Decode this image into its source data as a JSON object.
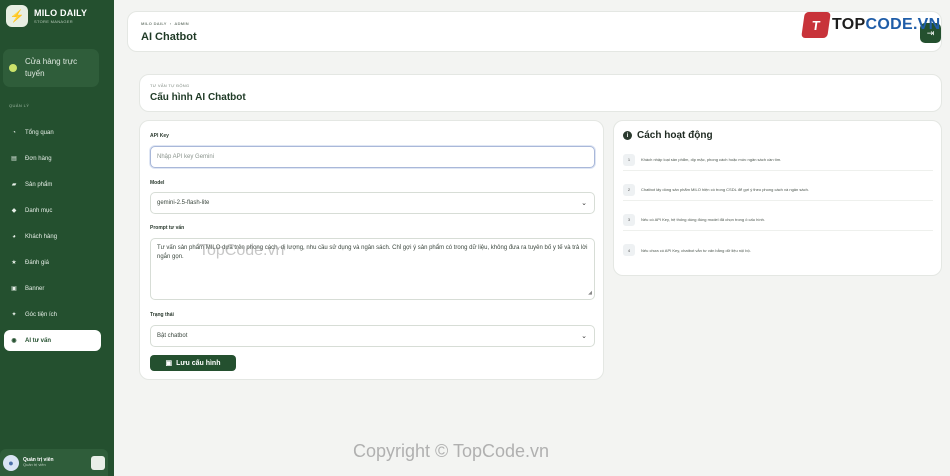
{
  "brand": {
    "name": "MILO DAILY",
    "subtitle": "STORE MANAGER",
    "logo_icon": "bolt-icon"
  },
  "store": {
    "label": "Cửa hàng trực tuyến",
    "status_color": "#cbe36a"
  },
  "sidebar": {
    "section_label": "QUẢN LÝ",
    "items": [
      {
        "label": "Tổng quan",
        "icon": "dashboard-icon",
        "glyph": "◔",
        "active": false
      },
      {
        "label": "Đơn hàng",
        "icon": "receipt-icon",
        "glyph": "▤",
        "active": false
      },
      {
        "label": "Sản phẩm",
        "icon": "box-icon",
        "glyph": "▰",
        "active": false
      },
      {
        "label": "Danh mục",
        "icon": "tag-icon",
        "glyph": "◆",
        "active": false
      },
      {
        "label": "Khách hàng",
        "icon": "users-icon",
        "glyph": "◕",
        "active": false
      },
      {
        "label": "Đánh giá",
        "icon": "star-icon",
        "glyph": "★",
        "active": false
      },
      {
        "label": "Banner",
        "icon": "image-icon",
        "glyph": "▣",
        "active": false
      },
      {
        "label": "Góc tiện ích",
        "icon": "lightbulb-icon",
        "glyph": "✦",
        "active": false
      },
      {
        "label": "AI tư vấn",
        "icon": "chat-icon",
        "glyph": "◉",
        "active": true
      }
    ]
  },
  "user": {
    "name": "Quản trị viên",
    "role": "Quản trị viên"
  },
  "header": {
    "breadcrumb": [
      "MILO DAILY",
      "ADMIN"
    ],
    "title": "AI Chatbot",
    "logout_icon": "logout-icon"
  },
  "watermark": {
    "logo_letter": "T",
    "logo_text_a": "TOP",
    "logo_text_b": "CODE.VN",
    "mid": "TopCode.vn",
    "bottom": "Copyright © TopCode.vn"
  },
  "section": {
    "eyebrow": "TƯ VẤN TỰ ĐỘNG",
    "title": "Cấu hình AI Chatbot"
  },
  "form": {
    "api_key": {
      "label": "API Key",
      "value": "",
      "placeholder": "Nhập API key Gemini"
    },
    "model": {
      "label": "Model",
      "value": "gemini-2.5-flash-lite"
    },
    "prompt": {
      "label": "Prompt tư vấn",
      "value": "Tư vấn sản phẩm MILO dựa trên phong cách, dị lượng, nhu cầu sử dụng và ngân sách. Chỉ gợi ý sản phẩm có trong dữ liệu, không đưa ra tuyên bố y tế và trả lời ngắn gọn."
    },
    "status": {
      "label": "Trạng thái",
      "value": "Bật chatbot"
    },
    "save_label": "Lưu cấu hình"
  },
  "info": {
    "title": "Cách hoạt động",
    "steps": [
      {
        "num": "1",
        "text": "Khách nhập loại sản phẩm, dịp mặc, phong cách hoặc mức ngân sách cần tìm."
      },
      {
        "num": "2",
        "text": "Chatbot lấy dòng sản phẩm MILO hiện có trong CSDL để gợi ý theo phong cách và ngân sách."
      },
      {
        "num": "3",
        "text": "Nếu có API Key, hệ thống dùng đúng model đã chọn trong ô cấu hình."
      },
      {
        "num": "4",
        "text": "Nếu chưa có API Key, chatbot vẫn tư vấn bằng dữ liệu nội bộ."
      }
    ]
  },
  "colors": {
    "primary": "#24502f",
    "accent": "#cbe36a"
  }
}
